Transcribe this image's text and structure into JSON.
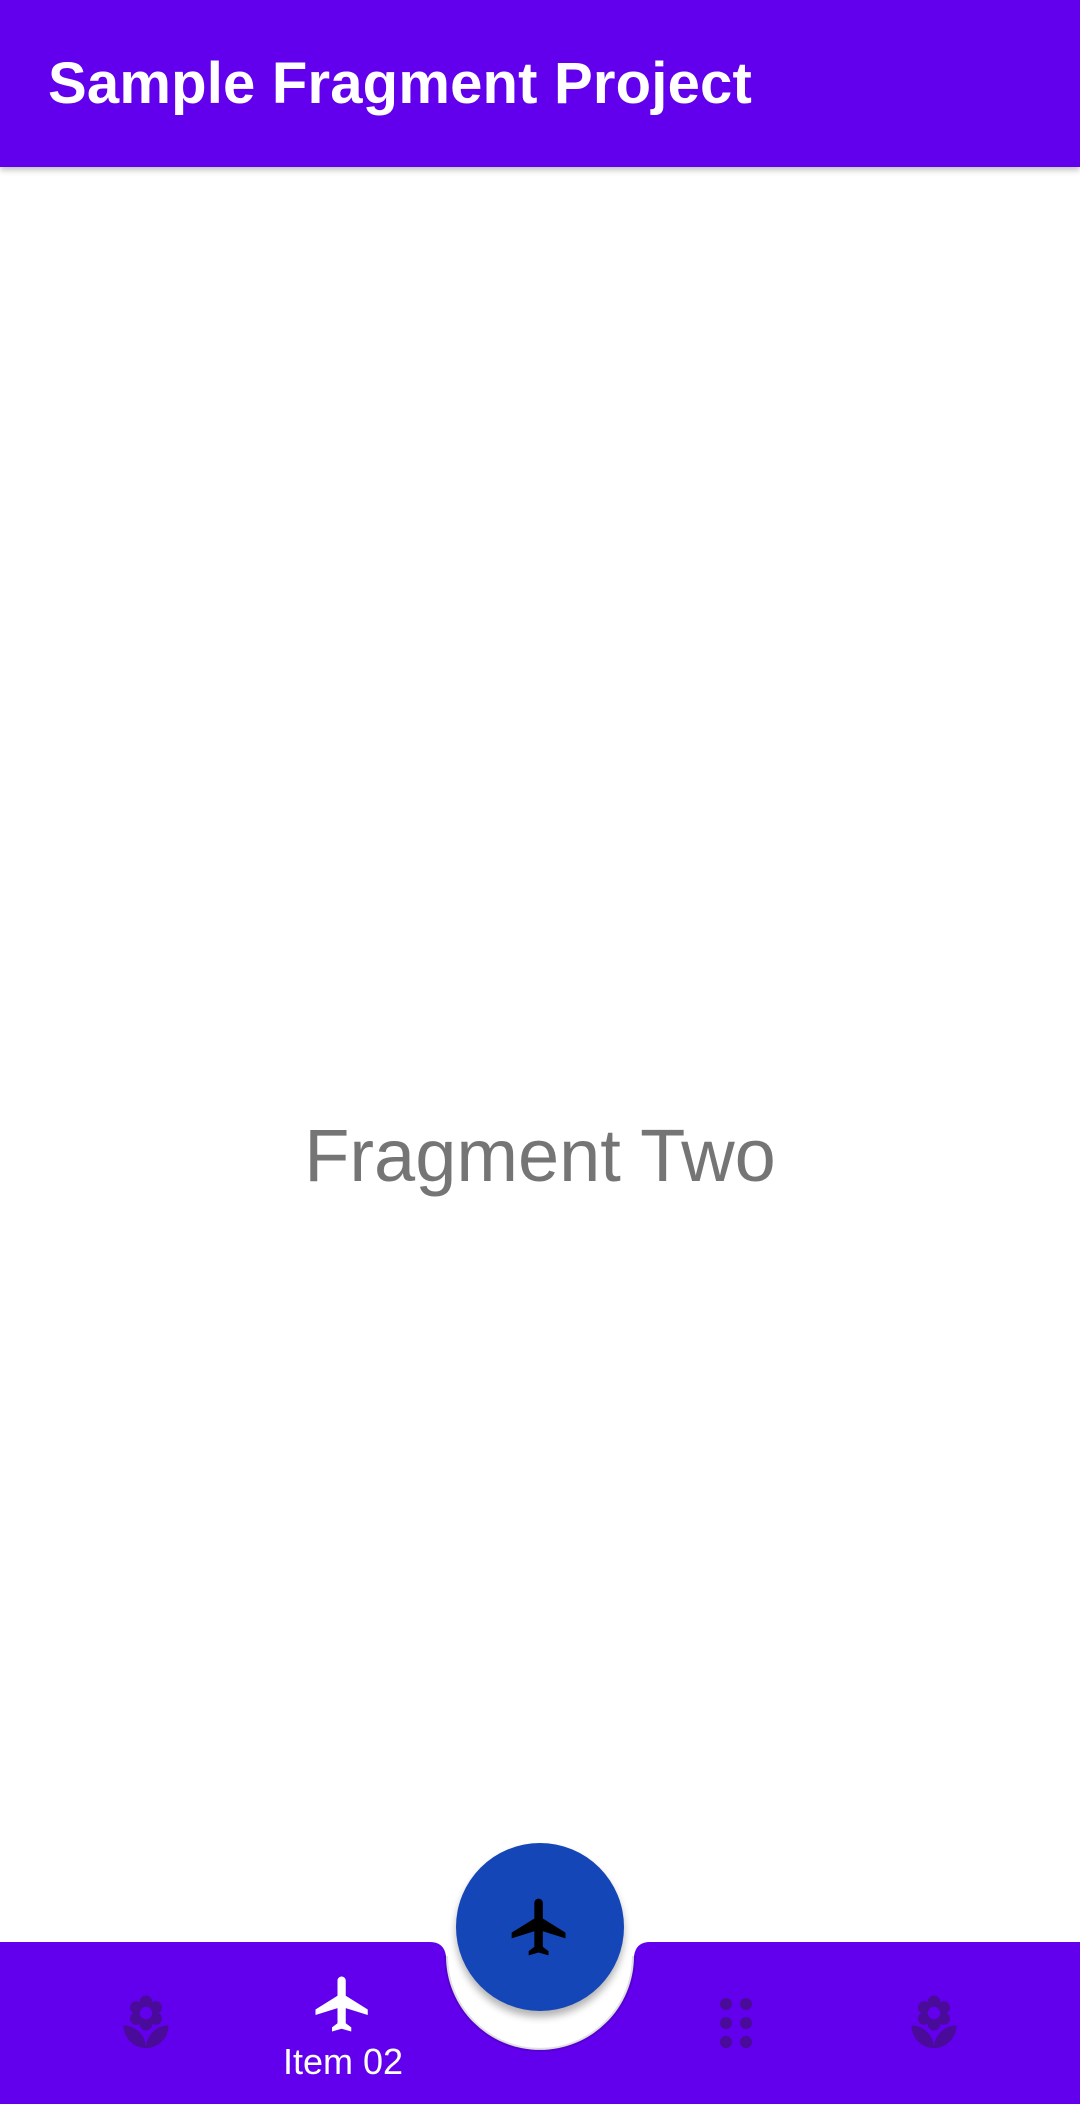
{
  "app_bar": {
    "title": "Sample Fragment Project",
    "color": "#6200EE"
  },
  "content": {
    "text": "Fragment Two"
  },
  "bottom_nav": {
    "color": "#6200EE",
    "items": [
      {
        "icon": "flower-icon",
        "label": "",
        "selected": false
      },
      {
        "icon": "airplane-icon",
        "label": "Item 02",
        "selected": true
      },
      {
        "icon": "dots-grid-icon",
        "label": "",
        "selected": false
      },
      {
        "icon": "flower-icon",
        "label": "",
        "selected": false
      }
    ]
  },
  "fab": {
    "icon": "airplane-icon",
    "color": "#1546B8"
  }
}
